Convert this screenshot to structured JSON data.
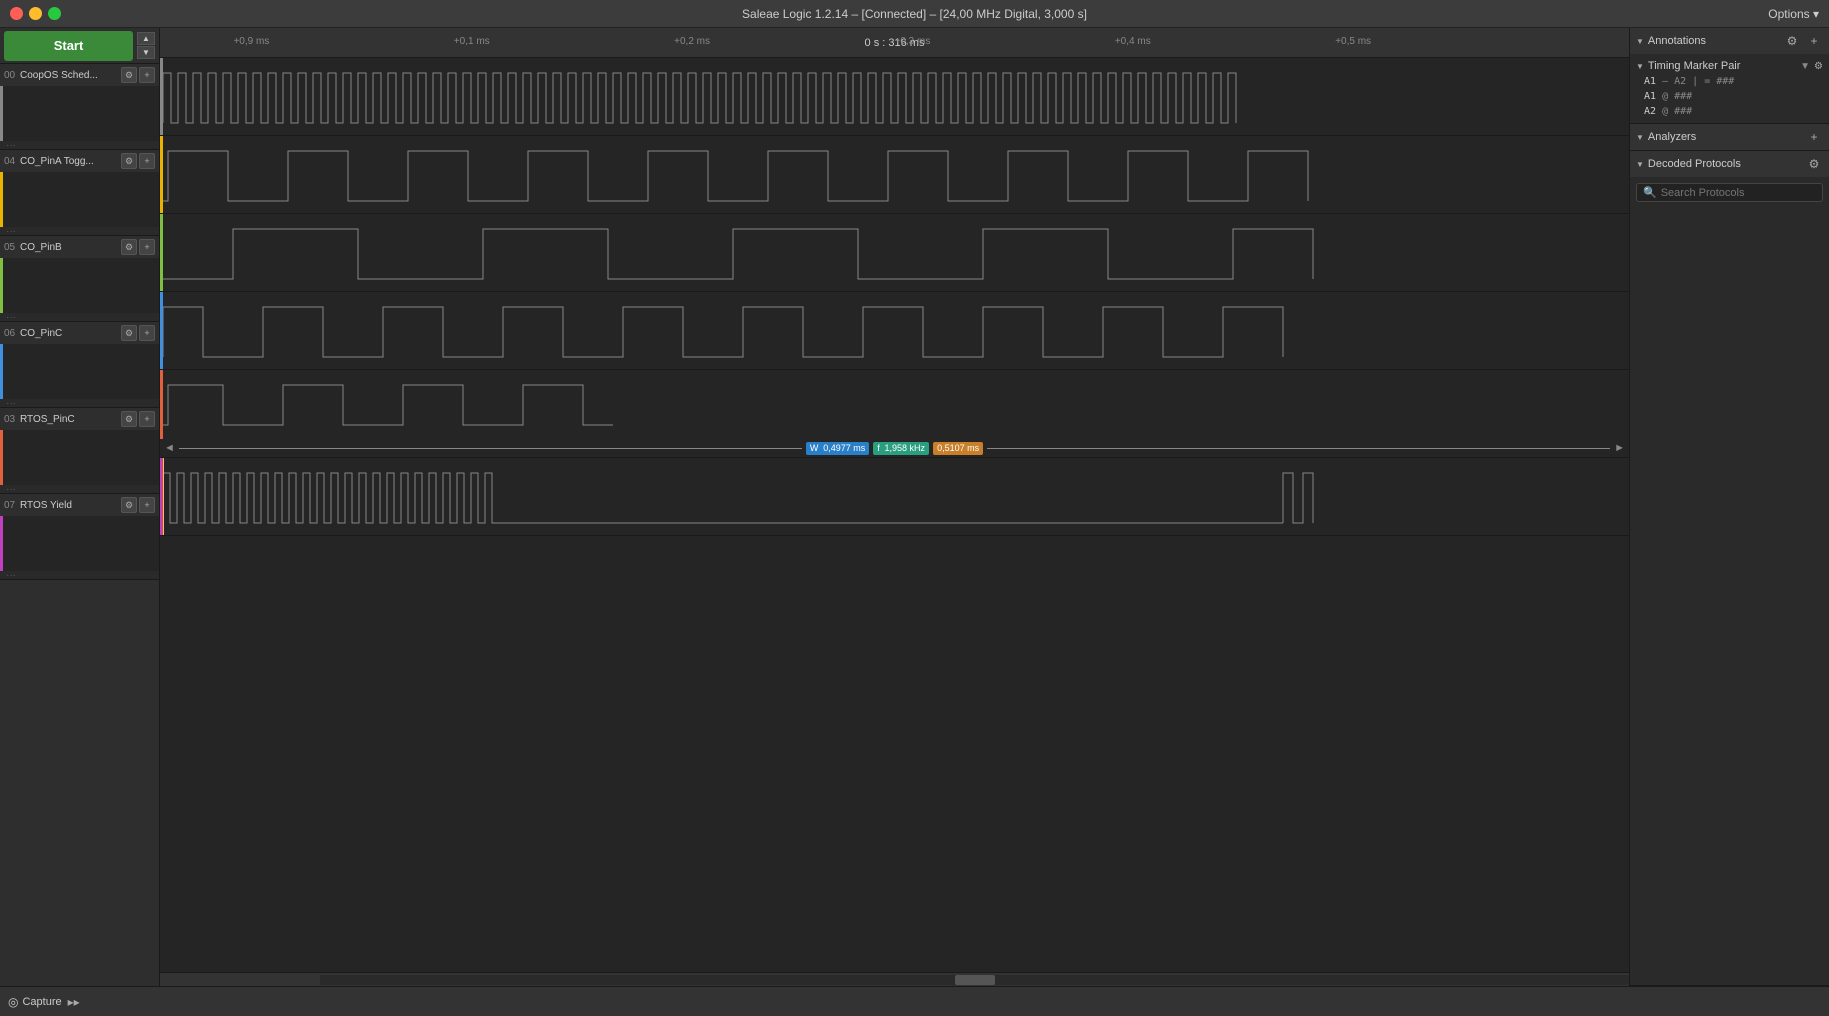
{
  "titlebar": {
    "title": "Saleae Logic 1.2.14 – [Connected] – [24,00 MHz Digital, 3,000 s]",
    "options_label": "Options ▾"
  },
  "start_button": "Start",
  "channels": [
    {
      "num": "00",
      "name": "CoopOS Sched...",
      "color": "#888888",
      "color_class": "ch-color-0"
    },
    {
      "num": "04",
      "name": "CO_PinA Togg...",
      "color": "#e8b400",
      "color_class": "ch-color-1"
    },
    {
      "num": "05",
      "name": "CO_PinB",
      "color": "#80c040",
      "color_class": "ch-color-2"
    },
    {
      "num": "06",
      "name": "CO_PinC",
      "color": "#4090e0",
      "color_class": "ch-color-3"
    },
    {
      "num": "03",
      "name": "RTOS_PinC",
      "color": "#e06040",
      "color_class": "ch-color-4"
    },
    {
      "num": "07",
      "name": "RTOS Yield",
      "color": "#c040c0",
      "color_class": "ch-color-5"
    }
  ],
  "time_ruler": {
    "center": "0 s : 316 ms",
    "ticks": [
      "+0,9 ms",
      "+0,1 ms",
      "+0,2 ms",
      "+0,3 ms",
      "+0,4 ms",
      "+0,5 ms"
    ]
  },
  "timing_markers": {
    "w_label": "W",
    "w_value": "0,4977 ms",
    "f_label": "f",
    "f_value": "1,958 kHz",
    "x_value": "0,5107 ms"
  },
  "annotations": {
    "section_label": "Annotations",
    "timing_pair_label": "Timing Marker Pair",
    "a1_a2_eq": "A1 – A2 | = ###",
    "a1_at": "A1 @ ###",
    "a2_at": "A2 @ ###"
  },
  "analyzers": {
    "section_label": "Analyzers"
  },
  "decoded_protocols": {
    "section_label": "Decoded Protocols",
    "search_placeholder": "Search Protocols"
  },
  "bottom_bar": {
    "capture_label": "Capture",
    "expand_icon": "▸▸"
  }
}
